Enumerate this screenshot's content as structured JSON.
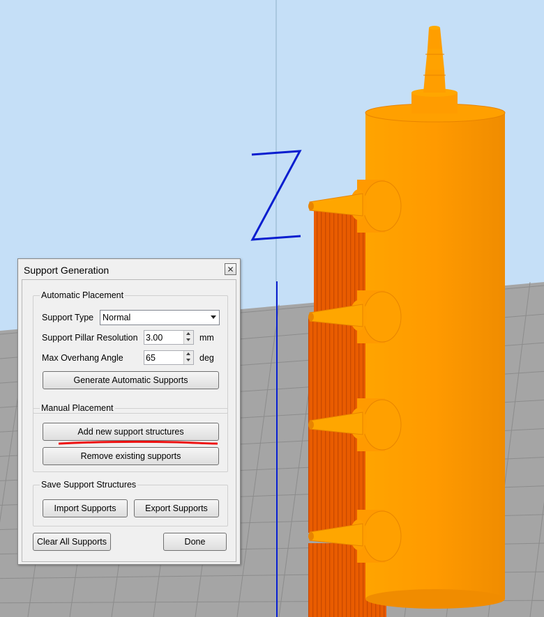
{
  "colors": {
    "sky": "#c5dff7",
    "floor": "#a5a5a5",
    "grid_line": "#8c8c8c",
    "model_orange": "#ff9e00",
    "model_shade": "#e88400",
    "support_orange": "#e95c00",
    "axis_blue": "#0a1ecf",
    "annotation_red": "#ee1111"
  },
  "viewport": {
    "axis_label": "Z"
  },
  "dialog": {
    "title": "Support Generation",
    "close_icon": "close-icon",
    "automatic": {
      "group_label": "Automatic Placement",
      "support_type_label": "Support Type",
      "support_type_value": "Normal",
      "pillar_resolution_label": "Support Pillar Resolution",
      "pillar_resolution_value": "3.00",
      "pillar_resolution_unit": "mm",
      "overhang_label": "Max Overhang Angle",
      "overhang_value": "65",
      "overhang_unit": "deg",
      "generate_label": "Generate Automatic Supports"
    },
    "manual": {
      "group_label": "Manual Placement",
      "add_label": "Add new support structures",
      "remove_label": "Remove existing supports"
    },
    "save": {
      "group_label": "Save Support Structures",
      "import_label": "Import Supports",
      "export_label": "Export Supports"
    },
    "clear_label": "Clear All Supports",
    "done_label": "Done"
  }
}
